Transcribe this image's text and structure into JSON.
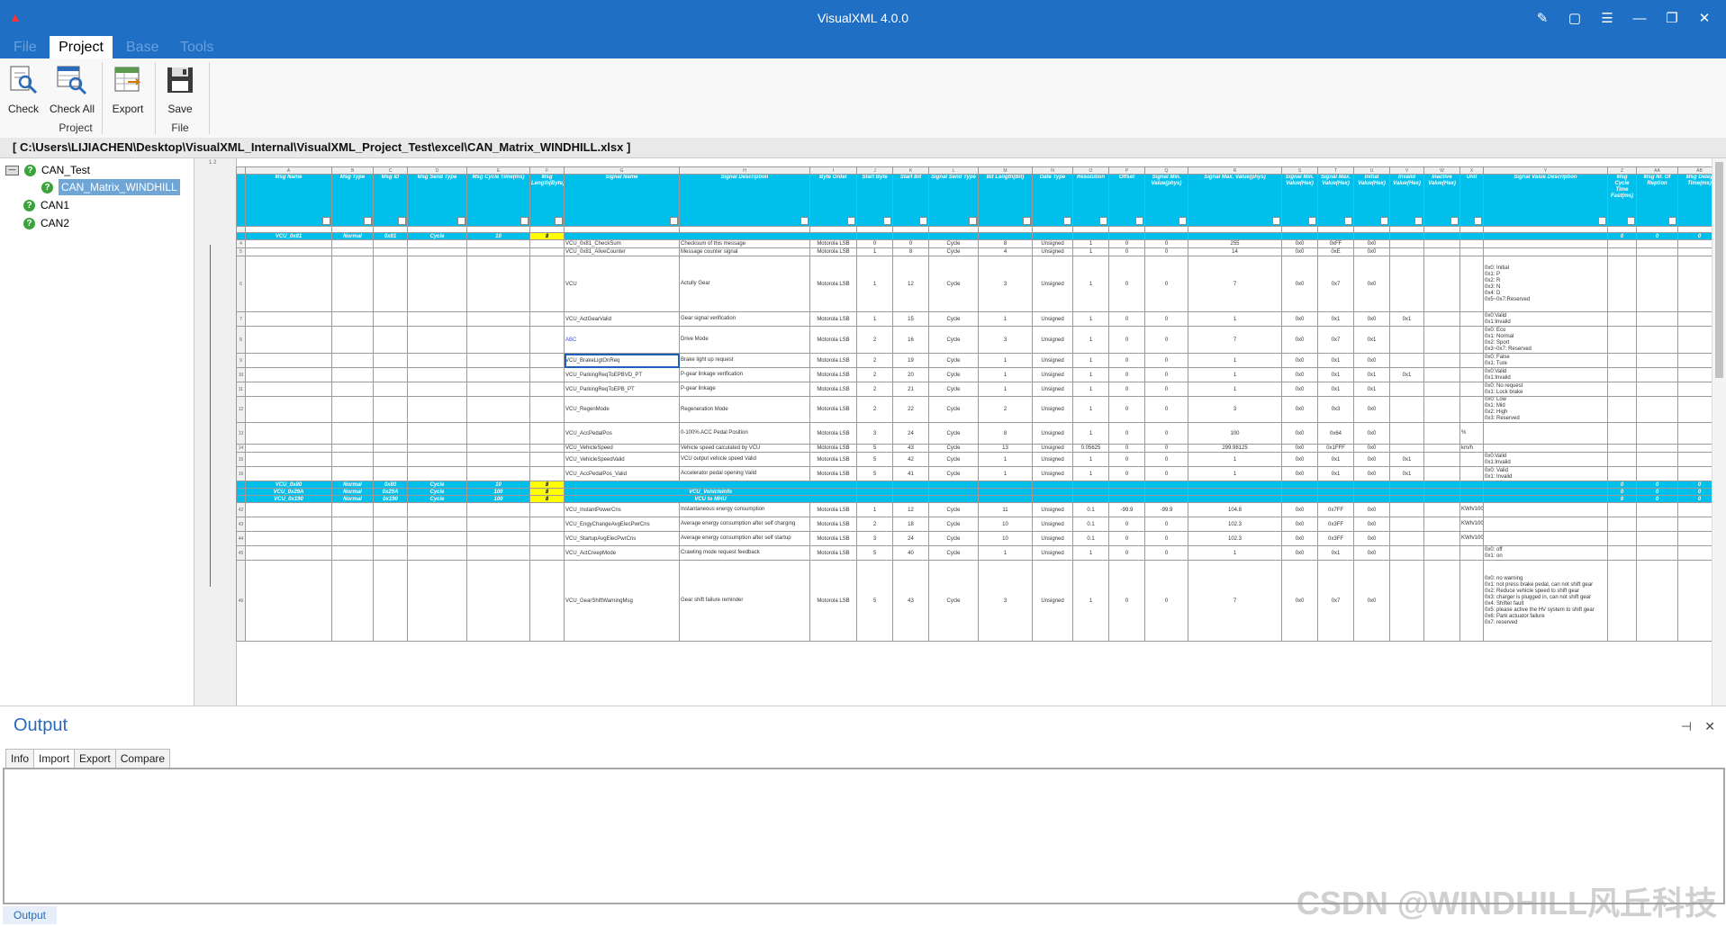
{
  "app": {
    "title": "VisualXML 4.0.0"
  },
  "menu": [
    {
      "label": "File"
    },
    {
      "label": "Project"
    },
    {
      "label": "Base"
    },
    {
      "label": "Tools"
    }
  ],
  "ribbon": {
    "check": "Check",
    "check_all": "Check All",
    "export": "Export",
    "save": "Save",
    "group_project": "Project",
    "group_file": "File"
  },
  "path": "[ C:\\Users\\LIJIACHEN\\Desktop\\VisualXML_Internal\\VisualXML_Project_Test\\excel\\CAN_Matrix_WINDHILL.xlsx ]",
  "tree": {
    "root": "CAN_Test",
    "child": "CAN_Matrix_WINDHILL",
    "can1": "CAN1",
    "can2": "CAN2"
  },
  "sheet": {
    "columns": [
      "Msg Name",
      "Msg Type",
      "Msg ID",
      "Msg Send Type",
      "Msg Cycle Time(ms)",
      "Msg Length(Byte)",
      "Signal Name",
      "Signal Description",
      "Byte Order",
      "Start Byte",
      "Start Bit",
      "Signal Send Type",
      "Bit Length(Bit)",
      "Date Type",
      "Resolution",
      "Offset",
      "Signal Min. Value(phys)",
      "Signal Max. Value(phys)",
      "Signal Min. Value(Hex)",
      "Signal Max. Value(Hex)",
      "Initial Value(Hex)",
      "Invalid Value(Hex)",
      "Inactive Value(Hex)",
      "Unit",
      "Signal Value Description",
      "Msg Cycle Time Fast(ms)",
      "Msg Nr. Of Reption",
      "Msg Delay Time(ms)"
    ],
    "col_letters": [
      "A",
      "B",
      "C",
      "D",
      "E",
      "F",
      "G",
      "H",
      "I",
      "J",
      "K",
      "L",
      "M",
      "N",
      "O",
      "P",
      "Q",
      "R",
      "S",
      "T",
      "U",
      "V",
      "W",
      "X",
      "Y",
      "Z",
      "AA",
      "AB"
    ],
    "msg_rows": [
      {
        "name": "VCU_0x81",
        "type": "Normal",
        "id": "0x81",
        "send": "Cycle",
        "cycle": "10",
        "len": "8",
        "fast": "0",
        "rep": "0",
        "delay": "0"
      },
      {
        "name": "VCU_0x80",
        "type": "Normal",
        "id": "0x80",
        "send": "Cycle",
        "cycle": "10",
        "len": "8",
        "fast": "0",
        "rep": "0",
        "delay": "0"
      },
      {
        "name": "VCU_0x29A",
        "type": "Normal",
        "id": "0x29A",
        "send": "Cycle",
        "cycle": "100",
        "len": "8",
        "sig": "VCU_VehicleInfo",
        "fast": "0",
        "rep": "0",
        "delay": "0"
      },
      {
        "name": "VCU_0x190",
        "type": "Normal",
        "id": "0x190",
        "send": "Cycle",
        "cycle": "100",
        "len": "8",
        "sig": "VCU to MHU",
        "fast": "0",
        "rep": "0",
        "delay": "0"
      }
    ],
    "signals_a": [
      {
        "n": "4",
        "name": "VCU_0x81_CheckSum",
        "desc": "Checksum of this message",
        "order": "Motorola LSB",
        "sbyte": "0",
        "sbit": "0",
        "stype": "Cycle",
        "blen": "8",
        "dtype": "Unsigned",
        "res": "1",
        "off": "0",
        "min": "0",
        "max": "255",
        "minh": "0x0",
        "maxh": "0xFF",
        "init": "0x0",
        "inv": "",
        "unit": "",
        "vdesc": ""
      },
      {
        "n": "5",
        "name": "VCU_0x81_AliveCounter",
        "desc": "Message counter signal",
        "order": "Motorola LSB",
        "sbyte": "1",
        "sbit": "8",
        "stype": "Cycle",
        "blen": "4",
        "dtype": "Unsigned",
        "res": "1",
        "off": "0",
        "min": "0",
        "max": "14",
        "minh": "0x0",
        "maxh": "0xE",
        "init": "0x0",
        "inv": "",
        "unit": "",
        "vdesc": ""
      },
      {
        "n": "6",
        "name": "VCU",
        "desc": "Actully Gear",
        "order": "Motorola LSB",
        "sbyte": "1",
        "sbit": "12",
        "stype": "Cycle",
        "blen": "3",
        "dtype": "Unsigned",
        "res": "1",
        "off": "0",
        "min": "0",
        "max": "7",
        "minh": "0x0",
        "maxh": "0x7",
        "init": "0x0",
        "inv": "",
        "unit": "",
        "vdesc": "0x0: Initial\n0x1: P\n0x2: R\n0x3: N\n0x4: D\n0x5~0x7:Reserved",
        "h": "tall"
      },
      {
        "n": "7",
        "name": "VCU_ActGearValid",
        "desc": "Gear signal verification",
        "order": "Motorola LSB",
        "sbyte": "1",
        "sbit": "15",
        "stype": "Cycle",
        "blen": "1",
        "dtype": "Unsigned",
        "res": "1",
        "off": "0",
        "min": "0",
        "max": "1",
        "minh": "0x0",
        "maxh": "0x1",
        "init": "0x0",
        "inv": "0x1",
        "unit": "",
        "vdesc": "0x0:Valid\n0x1:Invalid",
        "h": "mid"
      },
      {
        "n": "8",
        "name": "ABC",
        "desc": "Drive Mode",
        "order": "Motorola LSB",
        "sbyte": "2",
        "sbit": "16",
        "stype": "Cycle",
        "blen": "3",
        "dtype": "Unsigned",
        "res": "1",
        "off": "0",
        "min": "0",
        "max": "7",
        "minh": "0x0",
        "maxh": "0x7",
        "init": "0x1",
        "inv": "",
        "unit": "",
        "vdesc": "0x0: Eco\n0x1: Normal\n0x2: Sport\n0x3~0x7: Reserved",
        "h": "tall2",
        "abc": true
      },
      {
        "n": "9",
        "name": "VCU_BrakeLigtOnReq",
        "desc": "Brake light up request",
        "order": "Motorola LSB",
        "sbyte": "2",
        "sbit": "19",
        "stype": "Cycle",
        "blen": "1",
        "dtype": "Unsigned",
        "res": "1",
        "off": "0",
        "min": "0",
        "max": "1",
        "minh": "0x0",
        "maxh": "0x1",
        "init": "0x0",
        "inv": "",
        "unit": "",
        "vdesc": "0x0: False\n0x1: Ture",
        "h": "mid",
        "sel": true
      },
      {
        "n": "10",
        "name": "VCU_ParkingReqToEPBVD_PT",
        "desc": "P-gear linkage verification",
        "order": "Motorola LSB",
        "sbyte": "2",
        "sbit": "20",
        "stype": "Cycle",
        "blen": "1",
        "dtype": "Unsigned",
        "res": "1",
        "off": "0",
        "min": "0",
        "max": "1",
        "minh": "0x0",
        "maxh": "0x1",
        "init": "0x1",
        "inv": "0x1",
        "unit": "",
        "vdesc": "0x0:Valid\n0x1:Invalid",
        "h": "mid"
      },
      {
        "n": "11",
        "name": "VCU_ParkingReqToEPB_PT",
        "desc": "P-gear linkage",
        "order": "Motorola LSB",
        "sbyte": "2",
        "sbit": "21",
        "stype": "Cycle",
        "blen": "1",
        "dtype": "Unsigned",
        "res": "1",
        "off": "0",
        "min": "0",
        "max": "1",
        "minh": "0x0",
        "maxh": "0x1",
        "init": "0x1",
        "inv": "",
        "unit": "",
        "vdesc": "0x0: No request\n0x1: Lock brake",
        "h": "mid"
      },
      {
        "n": "12",
        "name": "VCU_RegenMode",
        "desc": "Regeneration Mode",
        "order": "Motorola LSB",
        "sbyte": "2",
        "sbit": "22",
        "stype": "Cycle",
        "blen": "2",
        "dtype": "Unsigned",
        "res": "1",
        "off": "0",
        "min": "0",
        "max": "3",
        "minh": "0x0",
        "maxh": "0x3",
        "init": "0x0",
        "inv": "",
        "unit": "",
        "vdesc": "0x0: Low\n0x1: Mid\n0x2: High\n0x3: Reserved",
        "h": "mid2"
      },
      {
        "n": "13",
        "name": "VCU_AccPedalPos",
        "desc": "0-100%\nACC Pedal Position",
        "order": "Motorola LSB",
        "sbyte": "3",
        "sbit": "24",
        "stype": "Cycle",
        "blen": "8",
        "dtype": "Unsigned",
        "res": "1",
        "off": "0",
        "min": "0",
        "max": "100",
        "minh": "0x0",
        "maxh": "0x64",
        "init": "0x0",
        "inv": "",
        "unit": "%",
        "vdesc": "",
        "h": "mid2"
      },
      {
        "n": "14",
        "name": "VCU_VehicleSpeed",
        "desc": "Vehicle speed calculated by VCU",
        "order": "Motorola LSB",
        "sbyte": "5",
        "sbit": "43",
        "stype": "Cycle",
        "blen": "13",
        "dtype": "Unsigned",
        "res": "0.05625",
        "off": "0",
        "min": "0",
        "max": "299.98125",
        "minh": "0x0",
        "maxh": "0x1FFF",
        "init": "0x0",
        "inv": "",
        "unit": "km/h",
        "vdesc": ""
      },
      {
        "n": "15",
        "name": "VCU_VehicleSpeedValid",
        "desc": "VCU output vehicle speed Valid",
        "order": "Motorola LSB",
        "sbyte": "5",
        "sbit": "42",
        "stype": "Cycle",
        "blen": "1",
        "dtype": "Unsigned",
        "res": "1",
        "off": "0",
        "min": "0",
        "max": "1",
        "minh": "0x0",
        "maxh": "0x1",
        "init": "0x0",
        "inv": "0x1",
        "unit": "",
        "vdesc": "0x0:Valid\n0x1:Invalid",
        "h": "mid"
      },
      {
        "n": "16",
        "name": "VCU_AccPedalPos_Valid",
        "desc": "Accelerator pedal opening Valid",
        "order": "Motorola LSB",
        "sbyte": "5",
        "sbit": "41",
        "stype": "Cycle",
        "blen": "1",
        "dtype": "Unsigned",
        "res": "1",
        "off": "0",
        "min": "0",
        "max": "1",
        "minh": "0x0",
        "maxh": "0x1",
        "init": "0x0",
        "inv": "0x1",
        "unit": "",
        "vdesc": "0x0: Valid\n0x1: Invalid",
        "h": "mid"
      }
    ],
    "signals_b": [
      {
        "n": "42",
        "name": "VCU_InstantPowerCns",
        "desc": "Instantaneous energy consumption",
        "order": "Motorola LSB",
        "sbyte": "1",
        "sbit": "12",
        "stype": "Cycle",
        "blen": "11",
        "dtype": "Unsigned",
        "res": "0.1",
        "off": "-99.9",
        "min": "-99.9",
        "max": "104.8",
        "minh": "0x0",
        "maxh": "0x7FF",
        "init": "0x0",
        "inv": "",
        "unit": "KWh/100Km",
        "vdesc": "",
        "h": "mid"
      },
      {
        "n": "43",
        "name": "VCU_EngyChangeAvgElecPwrCns",
        "desc": "Average energy consumption after self charging",
        "order": "Motorola LSB",
        "sbyte": "2",
        "sbit": "18",
        "stype": "Cycle",
        "blen": "10",
        "dtype": "Unsigned",
        "res": "0.1",
        "off": "0",
        "min": "0",
        "max": "102.3",
        "minh": "0x0",
        "maxh": "0x3FF",
        "init": "0x0",
        "inv": "",
        "unit": "KWh/100Km",
        "vdesc": "",
        "h": "mid"
      },
      {
        "n": "44",
        "name": "VCU_StartupAvgElecPwrCns",
        "desc": "Average energy consumption after self startup",
        "order": "Motorola LSB",
        "sbyte": "3",
        "sbit": "24",
        "stype": "Cycle",
        "blen": "10",
        "dtype": "Unsigned",
        "res": "0.1",
        "off": "0",
        "min": "0",
        "max": "102.3",
        "minh": "0x0",
        "maxh": "0x3FF",
        "init": "0x0",
        "inv": "",
        "unit": "KWh/100Km",
        "vdesc": "",
        "h": "mid"
      },
      {
        "n": "45",
        "name": "VCU_ActCreepMode",
        "desc": "Crawling mode request feedback",
        "order": "Motorola LSB",
        "sbyte": "5",
        "sbit": "40",
        "stype": "Cycle",
        "blen": "1",
        "dtype": "Unsigned",
        "res": "1",
        "off": "0",
        "min": "0",
        "max": "1",
        "minh": "0x0",
        "maxh": "0x1",
        "init": "0x0",
        "inv": "",
        "unit": "",
        "vdesc": "0x0: off\n0x1: on",
        "h": "mid"
      },
      {
        "n": "46",
        "name": "VCU_GearShiftWarningMsg",
        "desc": "Gear shift failure reminder",
        "order": "Motorola LSB",
        "sbyte": "5",
        "sbit": "43",
        "stype": "Cycle",
        "blen": "3",
        "dtype": "Unsigned",
        "res": "1",
        "off": "0",
        "min": "0",
        "max": "7",
        "minh": "0x0",
        "maxh": "0x7",
        "init": "0x0",
        "inv": "",
        "unit": "",
        "vdesc": "0x0: no warning\n0x1: not press brake pedal, can not shift gear\n0x2: Reduce vehicle speed to shift gear\n0x3: charger is plugged in, can not shift gear\n0x4: Shifter fault\n0x5: please active the HV system to shift gear\n0x6: Park actuator failure\n0x7: reserved",
        "h": "huge"
      }
    ]
  },
  "output": {
    "title": "Output",
    "tabs": [
      "Info",
      "Import",
      "Export",
      "Compare"
    ],
    "bottom_tab": "Output"
  },
  "watermark": "CSDN @WINDHILL风丘科技"
}
